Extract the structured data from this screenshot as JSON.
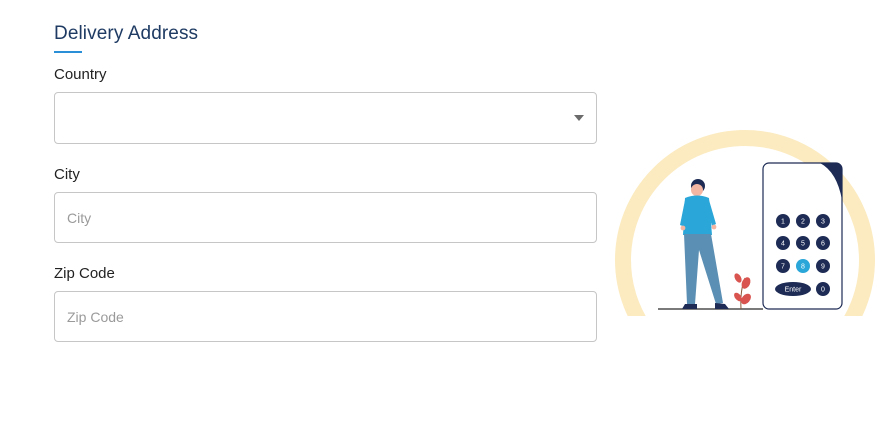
{
  "section": {
    "title": "Delivery Address"
  },
  "fields": {
    "country": {
      "label": "Country",
      "value": ""
    },
    "city": {
      "label": "City",
      "placeholder": "City",
      "value": ""
    },
    "zip": {
      "label": "Zip Code",
      "placeholder": "Zip Code",
      "value": ""
    }
  },
  "illustration": {
    "keypad_keys": [
      "1",
      "2",
      "3",
      "4",
      "5",
      "6",
      "7",
      "8",
      "9",
      "Enter",
      "0"
    ],
    "highlighted_key": "8",
    "colors": {
      "arc": "#fcebc0",
      "keypad_dark": "#1d2b55",
      "accent": "#2aa7d8",
      "plant": "#d9534f"
    }
  }
}
